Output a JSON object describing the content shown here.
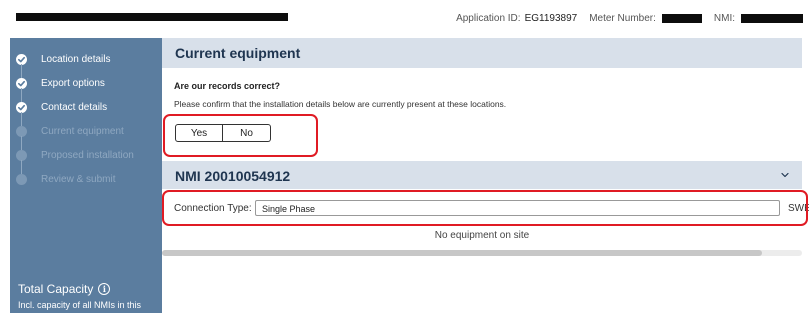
{
  "header": {
    "app_id_label": "Application ID:",
    "app_id_value": "EG1193897",
    "meter_label": "Meter Number:",
    "nmi_label": "NMI:"
  },
  "sidebar": {
    "steps": [
      {
        "label": "Location details",
        "status": "complete"
      },
      {
        "label": "Export options",
        "status": "complete"
      },
      {
        "label": "Contact details",
        "status": "complete"
      },
      {
        "label": "Current equipment",
        "status": "pending"
      },
      {
        "label": "Proposed installation",
        "status": "pending"
      },
      {
        "label": "Review & submit",
        "status": "pending"
      }
    ],
    "capacity_title": "Total Capacity",
    "capacity_note": "Incl. capacity of all NMIs in this group."
  },
  "main": {
    "title": "Current equipment",
    "question": "Are our records correct?",
    "instruction": "Please confirm that the installation details below are currently present at these locations.",
    "yes_label": "Yes",
    "no_label": "No",
    "nmi_title": "NMI 20010054912",
    "connection_label": "Connection Type:",
    "connection_value": "Single Phase",
    "swer_label": "SWER Line",
    "no_equipment": "No equipment on site"
  },
  "colors": {
    "sidebar_bg": "#5b7d9f",
    "section_header_bg": "#d8e0ea",
    "title_text": "#1f3550",
    "highlight": "#e01b24"
  }
}
